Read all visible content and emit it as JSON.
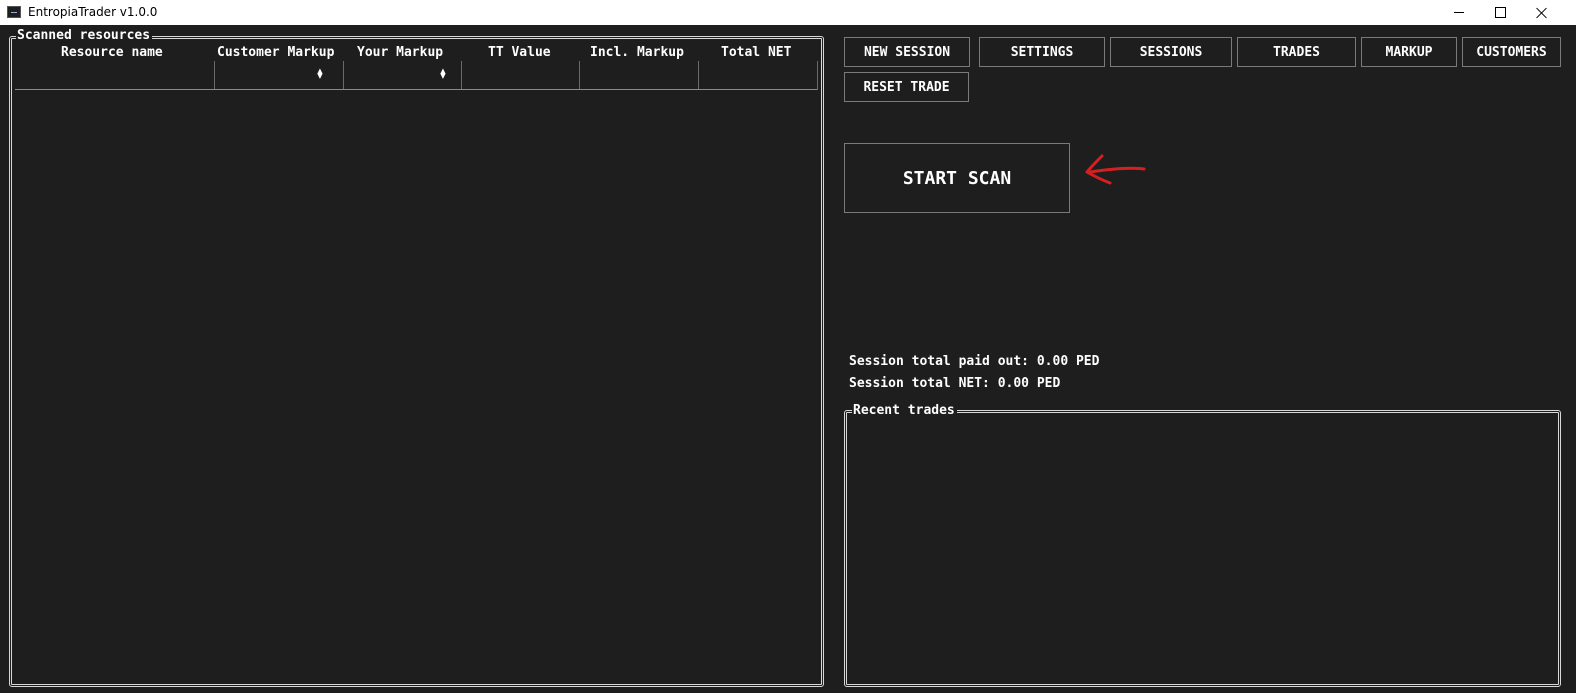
{
  "window": {
    "title": "EntropiaTrader v1.0.0"
  },
  "scanned": {
    "label": "Scanned resources",
    "columns": [
      "Resource name",
      "Customer Markup",
      "Your Markup",
      "TT Value",
      "Incl. Markup",
      "Total NET"
    ]
  },
  "toolbar": {
    "new_session": "NEW SESSION",
    "settings": "SETTINGS",
    "sessions": "SESSIONS",
    "trades": "TRADES",
    "markup": "MARKUP",
    "customers": "CUSTOMERS",
    "reset_trade": "RESET TRADE"
  },
  "scan": {
    "start_label": "START SCAN"
  },
  "session": {
    "paid_out": "Session total paid out: 0.00 PED",
    "net": "Session total NET: 0.00 PED"
  },
  "recent": {
    "label": "Recent trades"
  },
  "colors": {
    "background": "#1e1e1e",
    "annotation_arrow": "#d42020"
  },
  "icons": [
    "app-icon",
    "minimize-icon",
    "maximize-icon",
    "close-icon",
    "spinner-up-icon",
    "spinner-down-icon",
    "annotation-arrow-icon"
  ]
}
